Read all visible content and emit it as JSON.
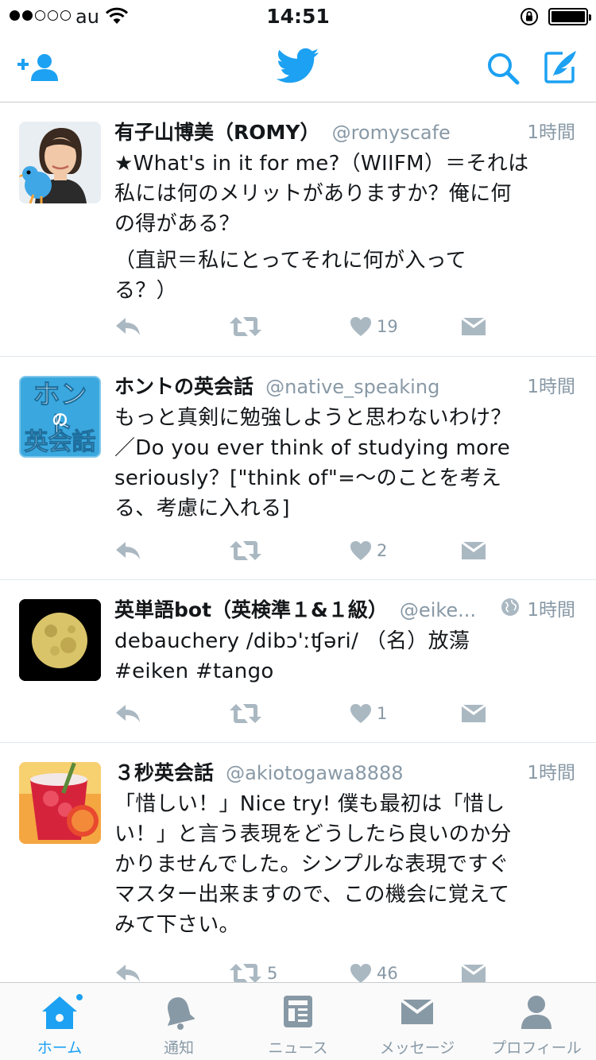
{
  "status_bar": {
    "carrier": "au",
    "time": "14:51",
    "signal_bars_filled": 2,
    "signal_bars_total": 5
  },
  "nav": {
    "add_user_icon": "add-user-icon",
    "logo_icon": "twitter-bird-icon",
    "search_icon": "search-icon",
    "compose_icon": "compose-icon"
  },
  "colors": {
    "accent": "#1da1f2",
    "muted": "#8899a6",
    "icon_gray": "#aab8c2"
  },
  "tweets": [
    {
      "name": "有子山博美（ROMY）",
      "handle": "@romyscafe",
      "time": "1時間",
      "text_lines": [
        "★What's in it for me?（WIIFM）＝それは",
        "私には何のメリットがありますか？俺に何",
        "の得がある？",
        "（直訳＝私にとってそれに何が入って",
        "る？）"
      ],
      "retweets": "",
      "likes": "19"
    },
    {
      "name": "ホントの英会話",
      "handle": "@native_speaking",
      "time": "1時間",
      "avatar_text": [
        "ホント",
        "の",
        "英会話"
      ],
      "text_lines": [
        "もっと真剣に勉強しようと思わないわけ？",
        "／Do you ever think of studying more",
        "seriously？[\"think of\"=〜のことを考え",
        "る、考慮に入れる]"
      ],
      "retweets": "",
      "likes": "2"
    },
    {
      "name": "英単語bot（英検準１&１級）",
      "handle": "@eike...",
      "time": "1時間",
      "text_lines": [
        "debauchery /dibɔ'ːʧəri/ （名）放蕩",
        "#eiken #tango"
      ],
      "retweets": "",
      "likes": "1"
    },
    {
      "name": "３秒英会話",
      "handle": "@akiotogawa8888",
      "time": "1時間",
      "text_lines": [
        "「惜しい！」Nice try! 僕も最初は「惜し",
        "い！」と言う表現をどうしたら良いのか分",
        "かりませんでした。シンプルな表現ですぐ",
        "マスター出来ますので、この機会に覚えて",
        "みて下さい。"
      ],
      "retweets": "5",
      "likes": "46"
    }
  ],
  "tabs": [
    {
      "label": "ホーム",
      "icon": "home-icon",
      "active": true
    },
    {
      "label": "通知",
      "icon": "bell-icon",
      "active": false
    },
    {
      "label": "ニュース",
      "icon": "news-icon",
      "active": false
    },
    {
      "label": "メッセージ",
      "icon": "message-icon",
      "active": false
    },
    {
      "label": "プロフィール",
      "icon": "profile-icon",
      "active": false
    }
  ]
}
